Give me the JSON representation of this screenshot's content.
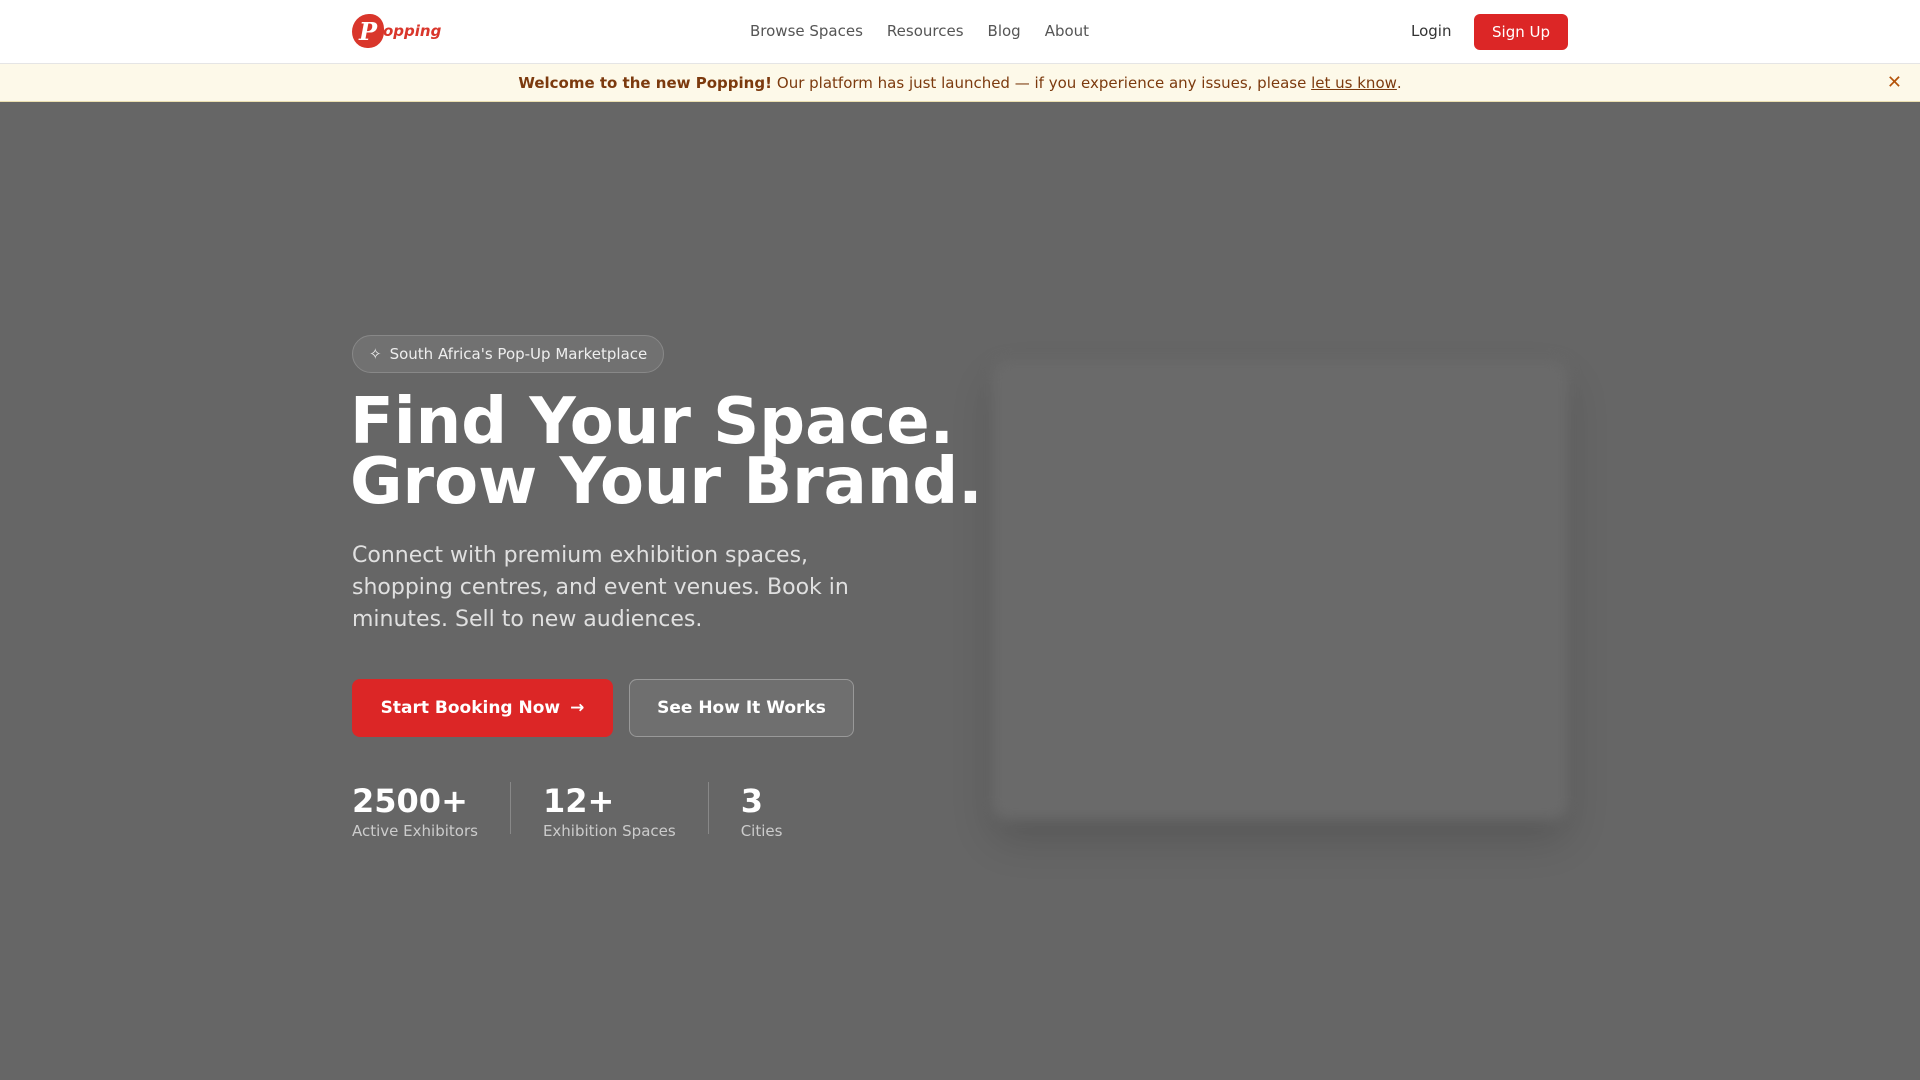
{
  "nav": {
    "logo_letter": "P",
    "logo_rest": "opping",
    "links": [
      "Browse Spaces",
      "Resources",
      "Blog",
      "About"
    ],
    "login": "Login",
    "signup": "Sign Up"
  },
  "banner": {
    "bold": "Welcome to the new Popping!",
    "text": "Our platform has just launched — if you experience any issues, please",
    "link": "let us know",
    "end": "."
  },
  "hero": {
    "badge": "South Africa's Pop-Up Marketplace",
    "title_line1": "Find Your Space.",
    "title_line2": "Grow Your Brand.",
    "lead": "Connect with premium exhibition spaces, shopping centres, and event venues. Book in minutes. Sell to new audiences.",
    "cta_primary": "Start Booking Now",
    "cta_secondary": "See How It Works",
    "stats": [
      {
        "value": "2500+",
        "label": "Active Exhibitors"
      },
      {
        "value": "12+",
        "label": "Exhibition Spaces"
      },
      {
        "value": "3",
        "label": "Cities"
      }
    ]
  },
  "colors": {
    "brand": "#dc2626"
  }
}
